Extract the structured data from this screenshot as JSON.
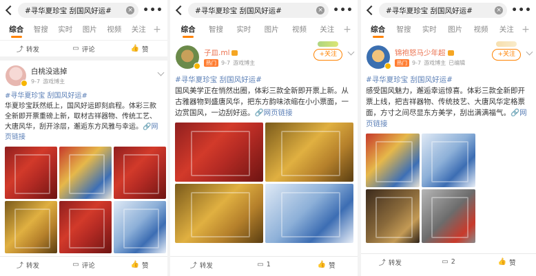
{
  "search_query": "#寻华夏珍宝 刮国风好运#",
  "tabs": [
    "综合",
    "智搜",
    "实时",
    "图片",
    "视频",
    "关注"
  ],
  "tab_plus": "+",
  "more_glyph": "•••",
  "clear_glyph": "×",
  "action_icons": {
    "repost": "repost-icon",
    "comment": "comment-icon",
    "like": "like-icon"
  },
  "colors": {
    "accent": "#ff8200",
    "link": "#5b7fb6",
    "name_orange": "#eb7350"
  },
  "screens": [
    {
      "top_actions": {
        "repost": "转发",
        "comment": "评论",
        "like": "赞"
      },
      "user": {
        "name": "白桃没逃掉",
        "date": "9-7",
        "role": "游戏博主"
      },
      "post": {
        "tag": "#寻华夏珍宝 刮国风好运#",
        "text": "华夏珍宝跃然纸上，国风好运即刻启程。体彩三款全新即开票重磅上新，取材古祥器物、传统工艺、大唐风华，刮开涂层，邂逅东方风雅与幸运。",
        "link": "网页链接"
      },
      "actions": {
        "repost": "转发",
        "comment": "评论",
        "like": "赞"
      }
    },
    {
      "user": {
        "name": "子皿.ml",
        "hot": "热门",
        "date": "9-7",
        "role": "游戏博主",
        "follow": "+关注"
      },
      "post": {
        "tag": "#寻华夏珍宝 刮国风好运#",
        "text": "国风美学正在悄然出圈，体彩三款全新即开票上新。从古雅器物到盛唐风华，把东方韵味浓缩在小小票面，一边赏国风，一边刮好运。",
        "link": "网页链接"
      },
      "actions": {
        "repost": "转发",
        "comment": "1",
        "like": "赞"
      }
    },
    {
      "user": {
        "name": "锦袍怒马少年超",
        "hot": "热门",
        "date": "9-7",
        "role": "游戏博主",
        "status": "已编辑",
        "follow": "+关注"
      },
      "post": {
        "tag": "#寻华夏珍宝 刮国风好运#",
        "text": "感受国风魅力，邂逅幸运惊喜。体彩三款全新即开票上线，把吉祥器物、传统技艺、大唐风华定格票面，方寸之间尽显东方美学，刮出满满福气。",
        "link": "网页链接"
      },
      "actions": {
        "repost": "转发",
        "comment": "2",
        "like": "赞"
      }
    }
  ]
}
